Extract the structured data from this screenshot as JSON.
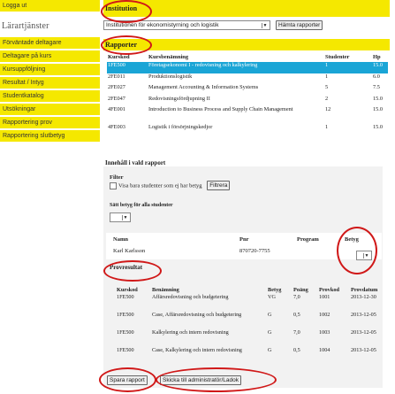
{
  "sidebar": {
    "logout": "Logga ut",
    "heading": "Lärartjänster",
    "items": [
      "Förväntade deltagare",
      "Deltagare på kurs",
      "Kursuppföljning",
      "Resultat / Intyg",
      "Studentkatalog",
      "Utsökningar",
      "Rapportering prov",
      "Rapportering slutbetyg"
    ]
  },
  "institution": {
    "title": "Institution",
    "selected": "Institutionen för ekonomistyrning och logistik",
    "fetch_button": "Hämta rapporter"
  },
  "reports": {
    "title": "Rapporter",
    "columns": [
      "Kurskod",
      "Kursbenämning",
      "Studenter",
      "Hp"
    ],
    "rows": [
      {
        "code": "1FE500",
        "name": "Företagsekonomi I - redovisning och kalkylering",
        "students": "1",
        "hp": "15.0"
      },
      {
        "code": "2FE011",
        "name": "Produktionslogistik",
        "students": "1",
        "hp": "6.0"
      },
      {
        "code": "2FE027",
        "name": "Management Accounting & Information Systems",
        "students": "5",
        "hp": "7.5"
      },
      {
        "code": "2FE047",
        "name": "Redovisningsfördjupning II",
        "students": "2",
        "hp": "15.0"
      },
      {
        "code": "4FE001",
        "name": "Introduction to Business Process and Supply Chain Management",
        "students": "12",
        "hp": "15.0"
      },
      {
        "code": "4FE003",
        "name": "Logistik i försörjningskedjor",
        "students": "1",
        "hp": "15.0"
      }
    ]
  },
  "content": {
    "title": "Innehåll i vald rapport",
    "filter_label": "Filter",
    "filter_checkbox": "Visa bara studenter som ej har betyg",
    "filter_button": "Filtrera",
    "set_grade_label": "Sätt betyg för alla studenter"
  },
  "student": {
    "col_name": "Namn",
    "col_pnr": "Pnr",
    "col_program": "Program",
    "col_grade": "Betyg",
    "name": "Karl Karlsson",
    "pnr": "870720-7755"
  },
  "results": {
    "title": "Provresultat",
    "columns": [
      "Kurskod",
      "Benämning",
      "Betyg",
      "Poäng",
      "Provkod",
      "Provdatum"
    ],
    "rows": [
      {
        "code": "1FE500",
        "name": "Affärsredovisning och budgetering",
        "grade": "VG",
        "points": "7,0",
        "test": "1001",
        "date": "2013-12-30"
      },
      {
        "code": "1FE500",
        "name": "Case, Affärsredovisning och budgetering",
        "grade": "G",
        "points": "0,5",
        "test": "1002",
        "date": "2013-12-05"
      },
      {
        "code": "1FE500",
        "name": "Kalkylering och intern redovisning",
        "grade": "G",
        "points": "7,0",
        "test": "1003",
        "date": "2013-12-05"
      },
      {
        "code": "1FE500",
        "name": "Case, Kalkylering och intern redovisning",
        "grade": "G",
        "points": "0,5",
        "test": "1004",
        "date": "2013-12-05"
      }
    ]
  },
  "actions": {
    "save": "Spara rapport",
    "send": "Skicka till administratör/Ladok"
  },
  "colors": {
    "highlight": "#f5e800",
    "selected_row": "#1aa5d6",
    "annotation": "#d01818"
  }
}
